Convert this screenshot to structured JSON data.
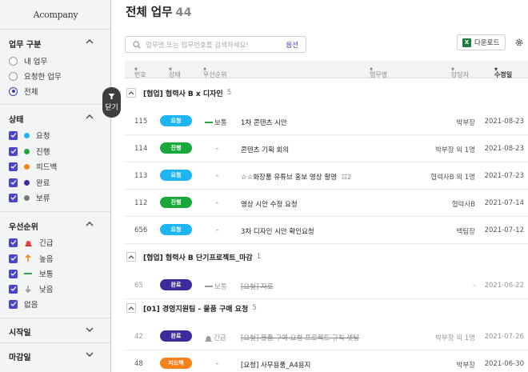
{
  "sidebar": {
    "logo": "Acompany",
    "work_type": {
      "title": "업무 구분",
      "options": [
        "내 업무",
        "요청한 업무",
        "전체"
      ],
      "selected": "전체"
    },
    "status": {
      "title": "상태",
      "items": [
        {
          "label": "요청",
          "color": "#1fb5f0"
        },
        {
          "label": "진행",
          "color": "#1aa83a"
        },
        {
          "label": "피드백",
          "color": "#f7821b"
        },
        {
          "label": "완료",
          "color": "#3c2b9a"
        },
        {
          "label": "보류",
          "color": "#777777"
        }
      ]
    },
    "priority": {
      "title": "우선순위",
      "items": [
        {
          "label": "긴급",
          "icon": "siren-icon"
        },
        {
          "label": "높음",
          "icon": "arrow-up-icon"
        },
        {
          "label": "보통",
          "icon": "dash-icon"
        },
        {
          "label": "낮음",
          "icon": "arrow-down-icon"
        },
        {
          "label": "없음",
          "icon": ""
        }
      ]
    },
    "start_date": {
      "title": "시작일"
    },
    "due_date": {
      "title": "마감일"
    },
    "toggle_label": "닫기"
  },
  "header": {
    "title": "전체 업무",
    "count": "44",
    "search_placeholder": "업무명 또는 업무번호를 검색하세요!",
    "search_option": "옵션",
    "download_label": "다운로드"
  },
  "table": {
    "columns": {
      "number": "번호",
      "status": "상태",
      "priority": "우선순위",
      "title": "업무명",
      "assignee": "담당자",
      "modified": "수정일"
    },
    "groups": [
      {
        "name": "[협업] 협력사 B x 디자인",
        "count": "5",
        "rows": [
          {
            "num": "115",
            "status": "요청",
            "priority": "보통",
            "title": "1차 콘텐츠 시안",
            "assignee": "박부장",
            "date": "2021-08-23"
          },
          {
            "num": "114",
            "status": "진행",
            "priority": "-",
            "title": "콘텐츠 기획 회의",
            "assignee": "박부장 외 1명",
            "date": "2021-08-23"
          },
          {
            "num": "113",
            "status": "요청",
            "priority": "-",
            "title": "☆☆화장품 유튜브 홍보 영상 촬영",
            "subtasks": "2",
            "assignee": "협력사B 외 1명",
            "date": "2021-07-23"
          },
          {
            "num": "112",
            "status": "진행",
            "priority": "-",
            "title": "영상 시안 수정 요청",
            "assignee": "협력사B",
            "date": "2021-07-14"
          },
          {
            "num": "656",
            "status": "요청",
            "priority": "-",
            "title": "3차 디자인 시안 확인요청",
            "assignee": "백팀장",
            "date": "2021-07-12"
          }
        ]
      },
      {
        "name": "[협업] 협력사 B 단기프로젝트_마감",
        "count": "1",
        "rows": [
          {
            "num": "65",
            "status": "완료",
            "priority": "보통",
            "title": "[요청] 자료",
            "assignee": "-",
            "date": "2021-06-22"
          }
        ]
      },
      {
        "name": "[01] 경영지원팀 - 물품 구매 요청",
        "count": "5",
        "rows": [
          {
            "num": "42",
            "status": "완료",
            "priority": "긴급",
            "title": "[요청] 물품 구매 요청 프로젝트 규칙 셋팅",
            "assignee": "박부장 외 1명",
            "date": "2021-07-26"
          },
          {
            "num": "48",
            "status": "피드백",
            "priority": "-",
            "title": "[요청] 사무용품_A4용지",
            "assignee": "박부장",
            "date": "2021-06-30"
          }
        ]
      }
    ]
  },
  "colors": {
    "accent": "#4b45c9",
    "request": "#1fb5f0",
    "progress": "#1aa83a",
    "feedback": "#f7821b",
    "done": "#3c2b9a",
    "hold": "#777777",
    "normal_priority": "#27a843"
  }
}
